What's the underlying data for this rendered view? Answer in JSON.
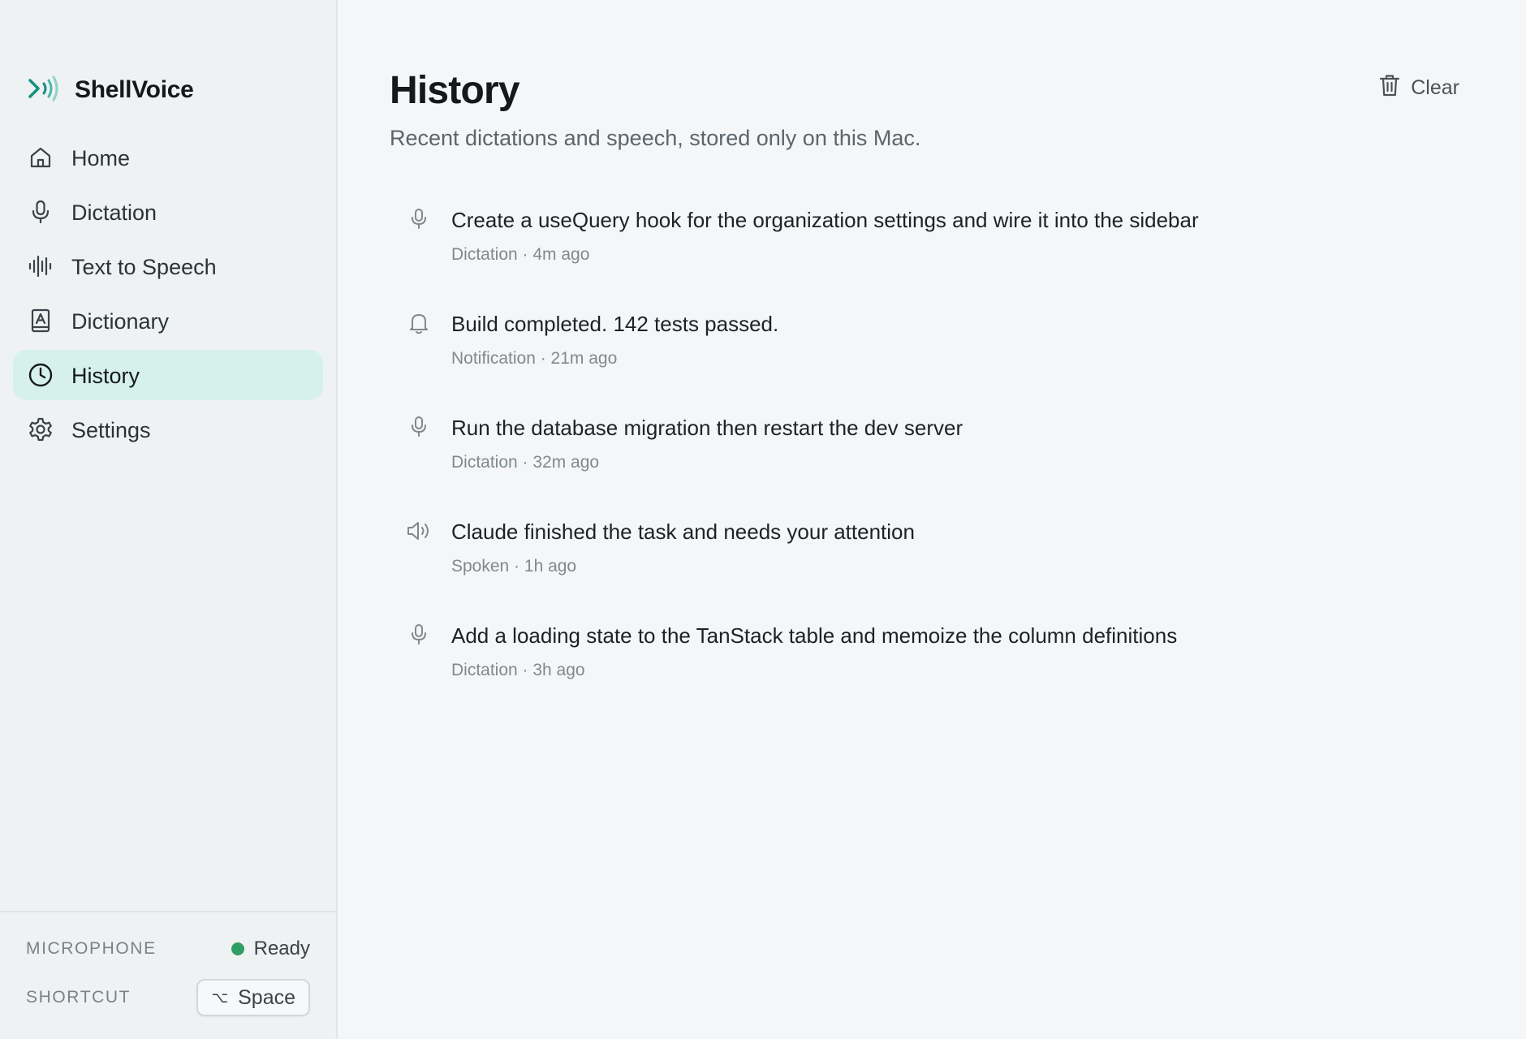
{
  "app": {
    "name": "ShellVoice",
    "brand_color": "#1a8f80"
  },
  "sidebar": {
    "items": [
      {
        "label": "Home",
        "icon": "home-icon",
        "active": false
      },
      {
        "label": "Dictation",
        "icon": "microphone-icon",
        "active": false
      },
      {
        "label": "Text to Speech",
        "icon": "waveform-icon",
        "active": false
      },
      {
        "label": "Dictionary",
        "icon": "book-icon",
        "active": false
      },
      {
        "label": "History",
        "icon": "clock-icon",
        "active": true
      },
      {
        "label": "Settings",
        "icon": "gear-icon",
        "active": false
      }
    ],
    "footer": {
      "microphone_label": "MICROPHONE",
      "microphone_status": "Ready",
      "status_color": "#2f9e62",
      "shortcut_label": "SHORTCUT",
      "shortcut_modifier": "⌥",
      "shortcut_key": "Space"
    }
  },
  "main": {
    "title": "History",
    "subtitle": "Recent dictations and speech, stored only on this Mac.",
    "clear_label": "Clear",
    "entries": [
      {
        "text": "Create a useQuery hook for the organization settings and wire it into the sidebar",
        "meta": "Dictation · 4m ago",
        "icon": "microphone-icon"
      },
      {
        "text": "Build completed. 142 tests passed.",
        "meta": "Notification · 21m ago",
        "icon": "bell-icon"
      },
      {
        "text": "Run the database migration then restart the dev server",
        "meta": "Dictation · 32m ago",
        "icon": "microphone-icon"
      },
      {
        "text": "Claude finished the task and needs your attention",
        "meta": "Spoken · 1h ago",
        "icon": "speaker-icon"
      },
      {
        "text": "Add a loading state to the TanStack table and memoize the column definitions",
        "meta": "Dictation · 3h ago",
        "icon": "microphone-icon"
      }
    ]
  }
}
